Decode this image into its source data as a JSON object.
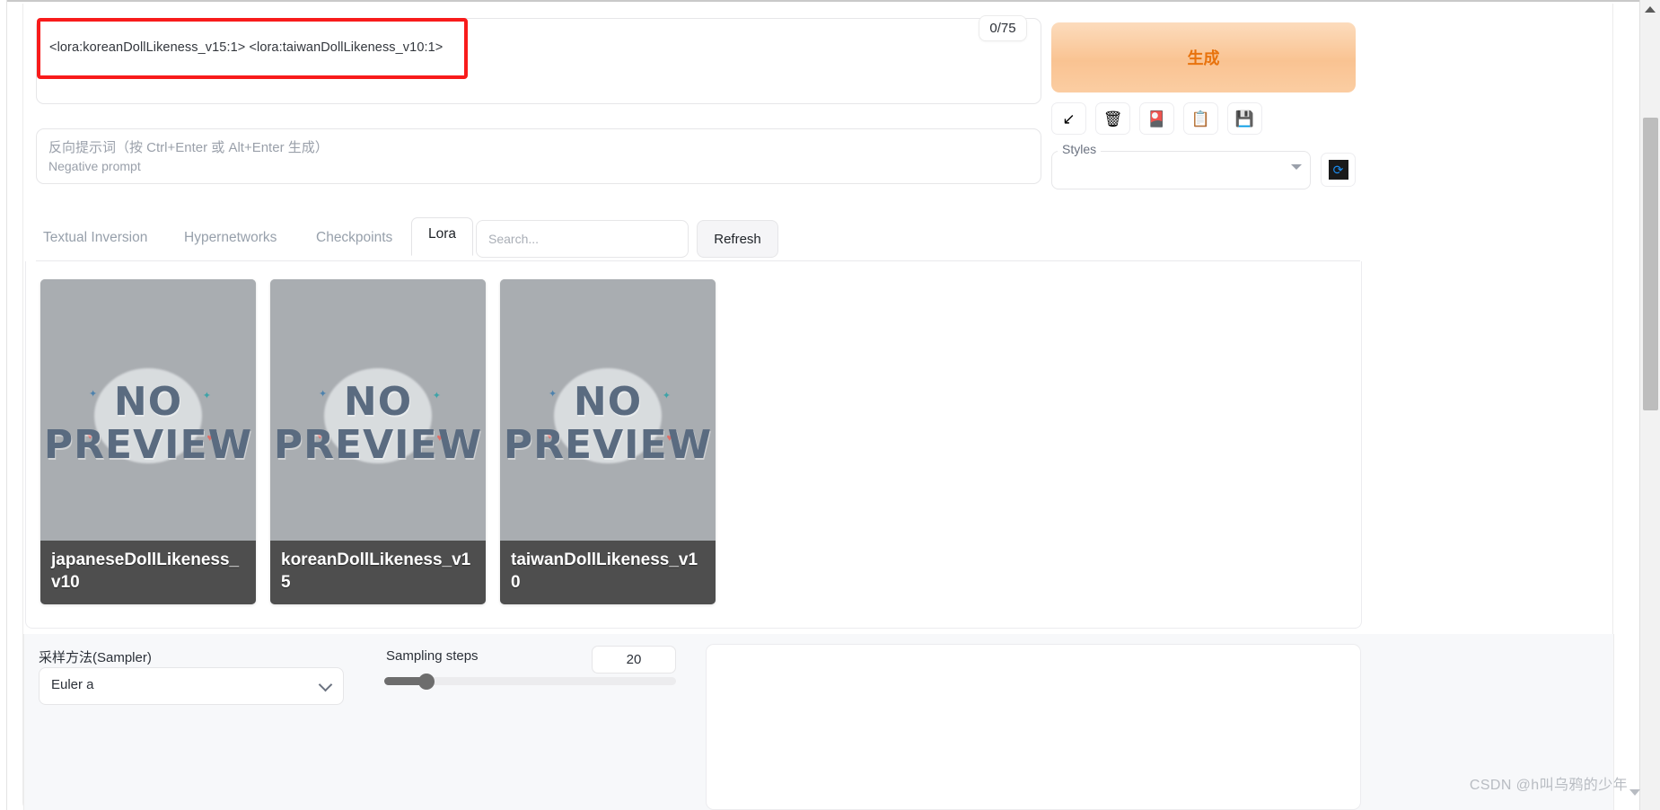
{
  "prompt": {
    "value": "<lora:koreanDollLikeness_v15:1> <lora:taiwanDollLikeness_v10:1>",
    "token_counter": "0/75"
  },
  "negative_prompt": {
    "placeholder_cn": "反向提示词（按 Ctrl+Enter 或 Alt+Enter 生成）",
    "placeholder_en": "Negative prompt",
    "value": ""
  },
  "actions": {
    "generate_label": "生成",
    "generate_color": "#e8730d",
    "tool_buttons": [
      {
        "name": "restore-progress-icon",
        "glyph": "↙"
      },
      {
        "name": "clear-prompt-trash-icon",
        "glyph": "🗑"
      },
      {
        "name": "apply-style-card-icon",
        "glyph": "🎴"
      },
      {
        "name": "paste-clipboard-icon",
        "glyph": "📋"
      },
      {
        "name": "save-style-floppy-icon",
        "glyph": "💾"
      }
    ]
  },
  "styles": {
    "legend": "Styles",
    "selected": "",
    "refresh_icon": "refresh-icon",
    "refresh_glyph": "⟳",
    "accent": "#1a8cf0"
  },
  "extra_networks": {
    "tabs": [
      {
        "label": "Textual Inversion",
        "active": false
      },
      {
        "label": "Hypernetworks",
        "active": false
      },
      {
        "label": "Checkpoints",
        "active": false
      },
      {
        "label": "Lora",
        "active": true
      }
    ],
    "search": {
      "value": "",
      "placeholder": "Search..."
    },
    "refresh_label": "Refresh",
    "cards": [
      {
        "name": "japaneseDollLikeness_v10",
        "preview": "NO PREVIEW"
      },
      {
        "name": "koreanDollLikeness_v15",
        "preview": "NO PREVIEW"
      },
      {
        "name": "taiwanDollLikeness_v10",
        "preview": "NO PREVIEW"
      }
    ],
    "preview_line1": "NO",
    "preview_line2": "PREVIEW"
  },
  "settings": {
    "sampler_label": "采样方法(Sampler)",
    "sampler_value": "Euler a",
    "steps_label": "Sampling steps",
    "steps_value": "20"
  },
  "watermark": "CSDN @h叫乌鸦的少年"
}
